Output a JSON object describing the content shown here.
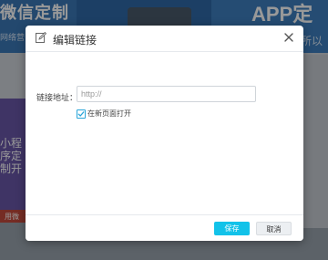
{
  "background": {
    "left_banner_title": "微信定制",
    "left_banner_sub": "网络营",
    "right_banner_title": "APP定制",
    "right_banner_sub": "所以",
    "mini_program_text": "小程序定制开",
    "footer_text": "用微"
  },
  "dialog": {
    "title": "编辑链接",
    "url_label": "链接地址：",
    "url_value": "",
    "url_placeholder": "http://",
    "open_new_window_label": "在新页面打开",
    "open_new_window_checked": true,
    "save_label": "保存",
    "cancel_label": "取消",
    "header_icon": "edit-icon",
    "close_icon": "close-icon"
  },
  "colors": {
    "accent": "#12c2e9",
    "checkbox": "#2aa6d9",
    "overlay": "rgba(0,0,0,0.40)"
  }
}
